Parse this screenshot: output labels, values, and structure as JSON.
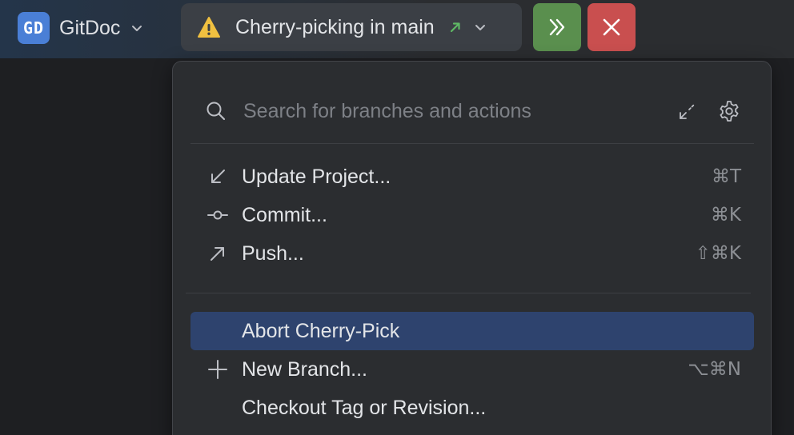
{
  "project": {
    "badge": "GD",
    "name": "GitDoc"
  },
  "vcs": {
    "status": "Cherry-picking in main"
  },
  "search": {
    "placeholder": "Search for branches and actions"
  },
  "menu": {
    "items": [
      {
        "label": "Update Project...",
        "shortcut": "⌘T",
        "icon": "update-arrow-icon"
      },
      {
        "label": "Commit...",
        "shortcut": "⌘K",
        "icon": "commit-icon"
      },
      {
        "label": "Push...",
        "shortcut": "⇧⌘K",
        "icon": "push-arrow-icon"
      },
      {
        "label": "Abort Cherry-Pick",
        "shortcut": "",
        "icon": ""
      },
      {
        "label": "New Branch...",
        "shortcut": "⌥⌘N",
        "icon": "plus-icon"
      },
      {
        "label": "Checkout Tag or Revision...",
        "shortcut": "",
        "icon": ""
      }
    ]
  },
  "colors": {
    "accent_selection": "#2e436e",
    "continue_green": "#5a8f4e",
    "abort_red": "#c94f4f",
    "warning_yellow": "#f0c040",
    "project_badge": "#4a7fd6"
  }
}
